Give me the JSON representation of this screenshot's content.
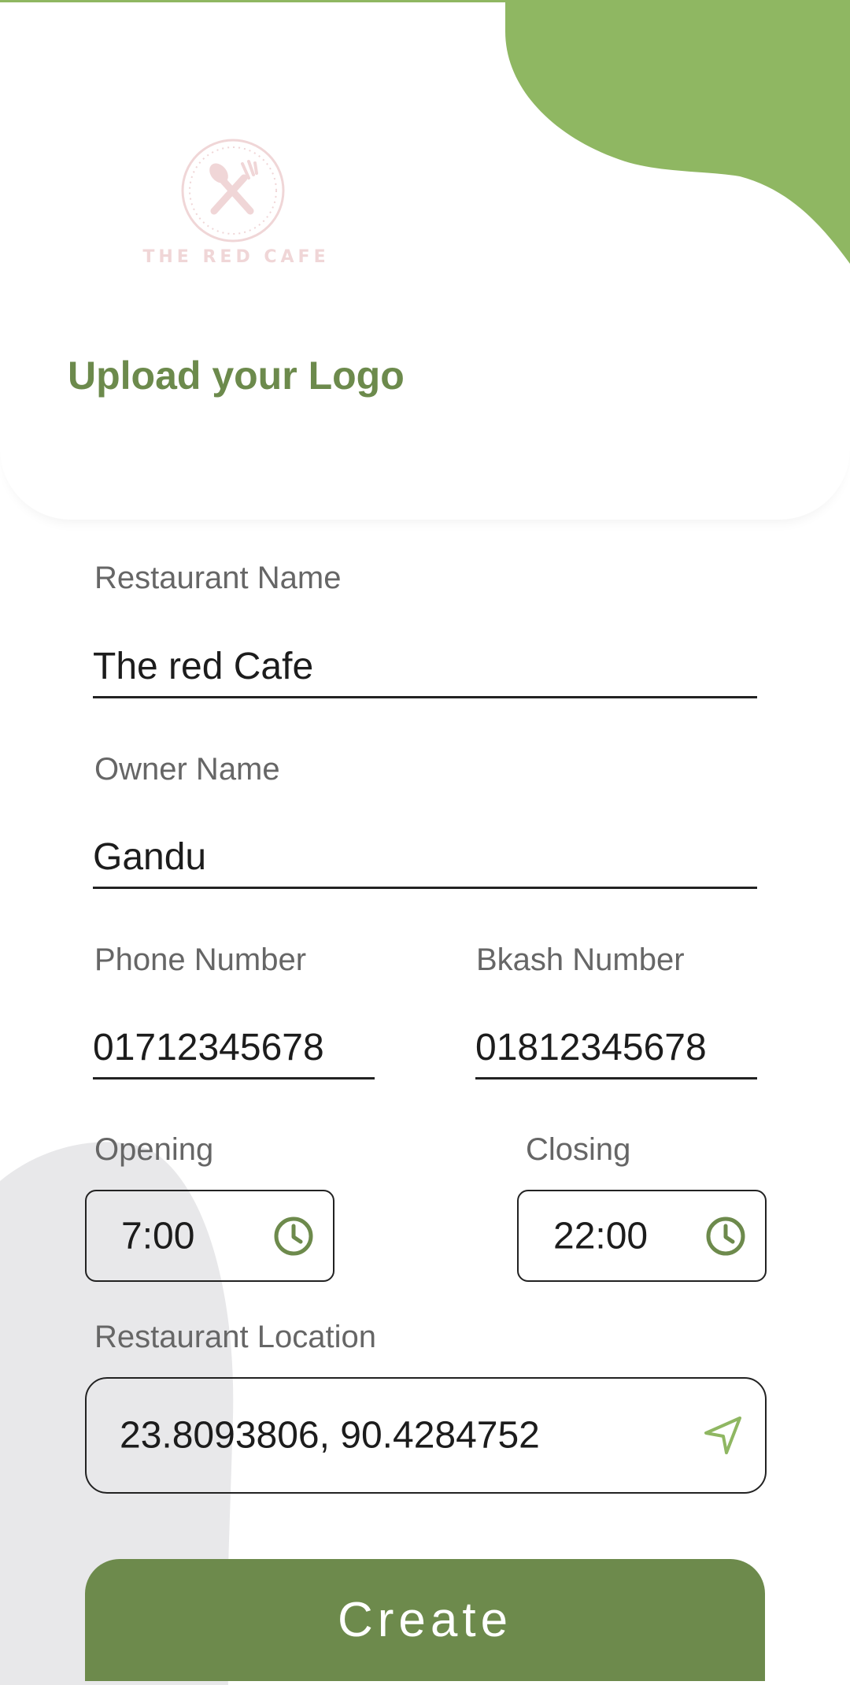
{
  "header": {
    "logo_text": "THE RED CAFE",
    "logo_icon": "spoon-fork-icon",
    "upload_title": "Upload your Logo"
  },
  "form": {
    "restaurant_name": {
      "label": "Restaurant Name",
      "value": "The red Cafe"
    },
    "owner_name": {
      "label": "Owner Name",
      "value": "Gandu"
    },
    "phone_number": {
      "label": "Phone Number",
      "value": "01712345678"
    },
    "bkash_number": {
      "label": "Bkash Number",
      "value": "01812345678"
    },
    "opening": {
      "label": "Opening",
      "value": "7:00",
      "icon": "clock-icon"
    },
    "closing": {
      "label": "Closing",
      "value": "22:00",
      "icon": "clock-icon"
    },
    "location": {
      "label": "Restaurant Location",
      "value": "23.8093806, 90.4284752",
      "icon": "navigation-arrow-icon"
    }
  },
  "actions": {
    "create_label": "Create"
  },
  "colors": {
    "accent_green": "#8fb762",
    "dark_green": "#6d8a4c",
    "logo_pink": "#f0d6d7",
    "gray_blob": "#e8e8ea"
  }
}
